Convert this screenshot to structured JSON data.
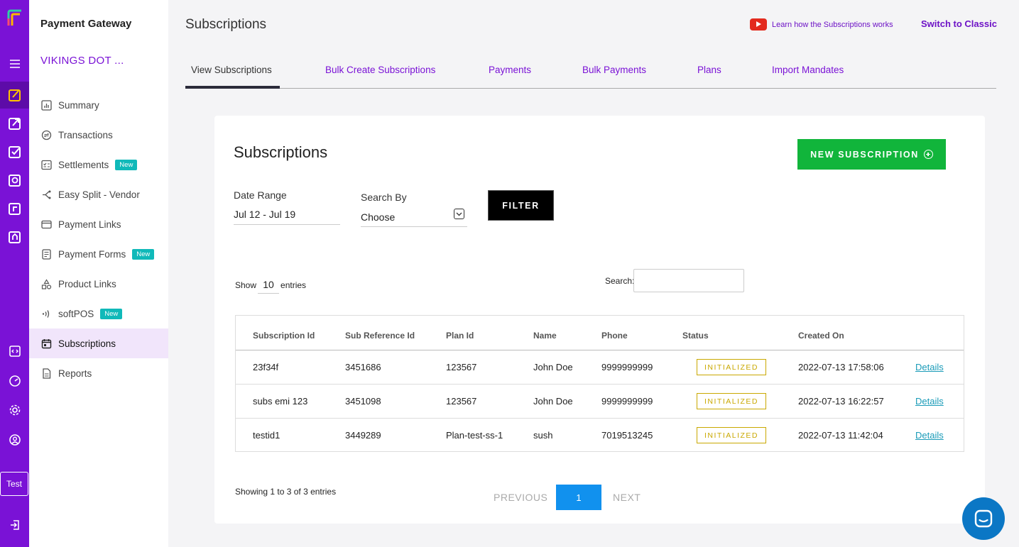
{
  "app": {
    "name": "Payment Gateway",
    "merchant": "VIKINGS DOT ...",
    "env_label": "Test"
  },
  "sidebar": {
    "items": [
      {
        "label": "Summary",
        "icon": "bar-chart-icon"
      },
      {
        "label": "Transactions",
        "icon": "arrows-exchange-icon"
      },
      {
        "label": "Settlements",
        "icon": "checklist-icon",
        "badge": "New"
      },
      {
        "label": "Easy Split - Vendor",
        "icon": "split-icon"
      },
      {
        "label": "Payment Links",
        "icon": "card-link-icon"
      },
      {
        "label": "Payment Forms",
        "icon": "form-icon",
        "badge": "New"
      },
      {
        "label": "Product Links",
        "icon": "shapes-icon"
      },
      {
        "label": "softPOS",
        "icon": "contactless-icon",
        "badge": "New"
      },
      {
        "label": "Subscriptions",
        "icon": "calendar-icon",
        "active": true
      },
      {
        "label": "Reports",
        "icon": "document-icon"
      }
    ]
  },
  "header": {
    "title": "Subscriptions",
    "learn_link": "Learn how the Subscriptions works",
    "switch_label": "Switch to Classic"
  },
  "tabs": [
    {
      "label": "View Subscriptions",
      "active": true
    },
    {
      "label": "Bulk Create Subscriptions"
    },
    {
      "label": "Payments"
    },
    {
      "label": "Bulk Payments"
    },
    {
      "label": "Plans"
    },
    {
      "label": "Import Mandates"
    }
  ],
  "card": {
    "title": "Subscriptions",
    "new_button": "NEW SUBSCRIPTION",
    "date_range_label": "Date Range",
    "date_range_value": "Jul 12 - Jul 19",
    "search_by_label": "Search By",
    "search_by_value": "Choose",
    "filter_button": "FILTER",
    "show_label": "Show",
    "show_value": "10",
    "entries_label": "entries",
    "search_label": "Search:",
    "search_value": ""
  },
  "table": {
    "columns": [
      "Subscription Id",
      "Sub Reference Id",
      "Plan Id",
      "Name",
      "Phone",
      "Status",
      "Created On"
    ],
    "rows": [
      {
        "sub_id": "23f34f",
        "ref_id": "3451686",
        "plan_id": "123567",
        "name": "John Doe",
        "phone": "9999999999",
        "status": "INITIALIZED",
        "created": "2022-07-13 17:58:06",
        "action": "Details"
      },
      {
        "sub_id": "subs emi 123",
        "ref_id": "3451098",
        "plan_id": "123567",
        "name": "John Doe",
        "phone": "9999999999",
        "status": "INITIALIZED",
        "created": "2022-07-13 16:22:57",
        "action": "Details"
      },
      {
        "sub_id": "testid1",
        "ref_id": "3449289",
        "plan_id": "Plan-test-ss-1",
        "name": "sush",
        "phone": "7019513245",
        "status": "INITIALIZED",
        "created": "2022-07-13 11:42:04",
        "action": "Details"
      }
    ]
  },
  "pagination": {
    "summary": "Showing 1 to 3 of 3 entries",
    "previous": "PREVIOUS",
    "current": "1",
    "next": "NEXT"
  },
  "colors": {
    "brand": "#7a12d6",
    "success": "#11b53b",
    "status_initialized": "#c9a800",
    "link": "#1a9bb8",
    "page_active": "#1191ee"
  }
}
